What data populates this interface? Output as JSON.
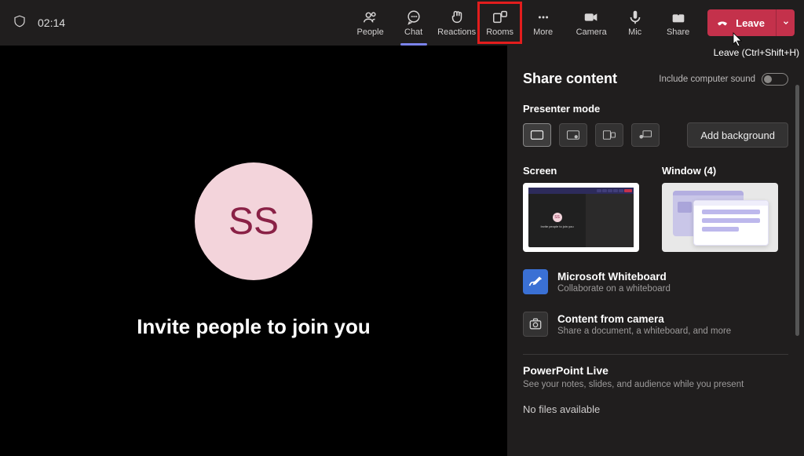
{
  "topbar": {
    "timer": "02:14",
    "items": {
      "people": "People",
      "chat": "Chat",
      "reactions": "Reactions",
      "rooms": "Rooms",
      "more": "More",
      "camera": "Camera",
      "mic": "Mic",
      "share": "Share"
    },
    "leave_label": "Leave",
    "leave_tooltip": "Leave (Ctrl+Shift+H)"
  },
  "stage": {
    "avatar_initials": "SS",
    "invite_text": "Invite people to join you"
  },
  "panel": {
    "title": "Share content",
    "include_sound_label": "Include computer sound",
    "presenter_mode_label": "Presenter mode",
    "add_background": "Add background",
    "screen_label": "Screen",
    "window_label": "Window (4)",
    "whiteboard": {
      "title": "Microsoft Whiteboard",
      "subtitle": "Collaborate on a whiteboard"
    },
    "camera_content": {
      "title": "Content from camera",
      "subtitle": "Share a document, a whiteboard, and more"
    },
    "ppt": {
      "title": "PowerPoint Live",
      "subtitle": "See your notes, slides, and audience while you present",
      "no_files": "No files available"
    }
  }
}
